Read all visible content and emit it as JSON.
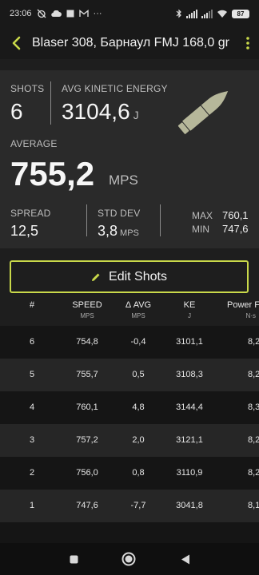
{
  "status_bar": {
    "time": "23:06",
    "battery": "87",
    "more": "···"
  },
  "app_bar": {
    "title": "Blaser 308, Барнаул FMJ 168,0 gr",
    "accent_color": "#c9d94a"
  },
  "summary": {
    "shots_label": "SHOTS",
    "shots_value": "6",
    "ke_label": "AVG KINETIC ENERGY",
    "ke_value": "3104,6",
    "ke_unit": "J",
    "average_label": "AVERAGE",
    "average_value": "755,2",
    "average_unit": "MPS",
    "spread_label": "SPREAD",
    "spread_value": "12,5",
    "std_label": "STD DEV",
    "std_value": "3,8",
    "std_unit": "MPS",
    "max_label": "MAX",
    "max_value": "760,1",
    "min_label": "MIN",
    "min_value": "747,6",
    "icon": "bullet-icon"
  },
  "edit_button": {
    "label": "Edit Shots",
    "icon": "pencil-icon"
  },
  "table": {
    "headers": [
      {
        "label": "#",
        "unit": ""
      },
      {
        "label": "SPEED",
        "unit": "MPS"
      },
      {
        "label": "Δ AVG",
        "unit": "MPS"
      },
      {
        "label": "KE",
        "unit": "J"
      },
      {
        "label": "Power F",
        "unit": "N·s"
      }
    ],
    "rows": [
      {
        "num": "6",
        "speed": "754,8",
        "delta": "-0,4",
        "ke": "3101,1",
        "pf": "8,2"
      },
      {
        "num": "5",
        "speed": "755,7",
        "delta": "0,5",
        "ke": "3108,3",
        "pf": "8,2"
      },
      {
        "num": "4",
        "speed": "760,1",
        "delta": "4,8",
        "ke": "3144,4",
        "pf": "8,3"
      },
      {
        "num": "3",
        "speed": "757,2",
        "delta": "2,0",
        "ke": "3121,1",
        "pf": "8,2"
      },
      {
        "num": "2",
        "speed": "756,0",
        "delta": "0,8",
        "ke": "3110,9",
        "pf": "8,2"
      },
      {
        "num": "1",
        "speed": "747,6",
        "delta": "-7,7",
        "ke": "3041,8",
        "pf": "8,1"
      }
    ]
  },
  "nav_bar": {
    "icons": [
      "recents-icon",
      "home-icon",
      "back-nav-icon"
    ]
  }
}
